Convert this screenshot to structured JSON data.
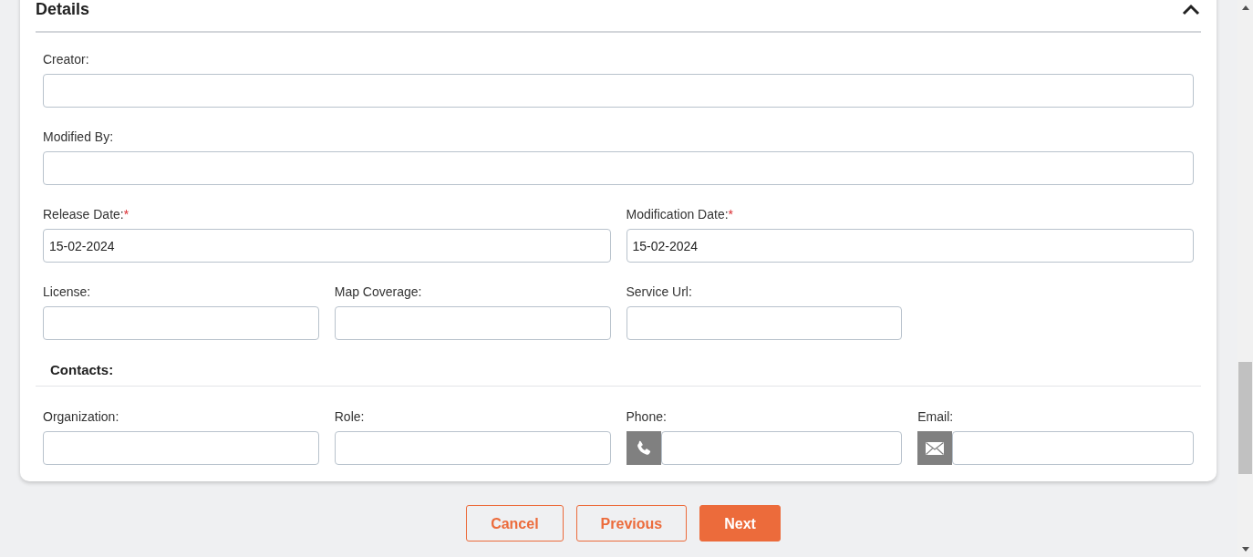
{
  "details": {
    "title": "Details",
    "expanded": true,
    "rows": [
      {
        "fields": [
          {
            "label": "Creator:"
          }
        ]
      },
      {
        "fields": [
          {
            "label": "Modified By:"
          }
        ]
      },
      {
        "fields": [
          {
            "label": "Release Date:",
            "mark": "*",
            "value": "15-02-2024"
          },
          {
            "label": "Modification Date:",
            "mark": "*",
            "value": "15-02-2024"
          }
        ]
      },
      {
        "fields": [
          {
            "label": "License:"
          },
          {
            "label": "Map Coverage:"
          },
          {
            "label": "Service Url:"
          }
        ]
      }
    ],
    "contacts": {
      "title": "Contacts:",
      "fields": [
        {
          "label": "Organization:",
          "kind": "text"
        },
        {
          "label": "Role:",
          "kind": "text"
        },
        {
          "label": "Phone:",
          "kind": "phone"
        },
        {
          "label": "Email:",
          "kind": "email"
        }
      ]
    }
  },
  "buttons": [
    {
      "label": "Cancel",
      "primary": false
    },
    {
      "label": "Previous",
      "primary": false
    },
    {
      "label": "Next",
      "primary": true
    }
  ]
}
